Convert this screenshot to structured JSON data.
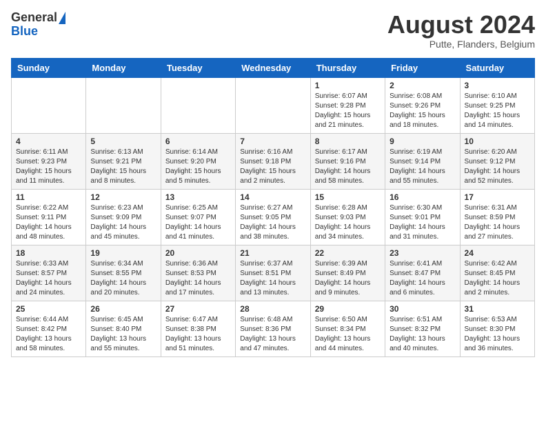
{
  "header": {
    "logo_general": "General",
    "logo_blue": "Blue",
    "month_year": "August 2024",
    "location": "Putte, Flanders, Belgium"
  },
  "weekdays": [
    "Sunday",
    "Monday",
    "Tuesday",
    "Wednesday",
    "Thursday",
    "Friday",
    "Saturday"
  ],
  "weeks": [
    [
      {
        "day": "",
        "info": ""
      },
      {
        "day": "",
        "info": ""
      },
      {
        "day": "",
        "info": ""
      },
      {
        "day": "",
        "info": ""
      },
      {
        "day": "1",
        "info": "Sunrise: 6:07 AM\nSunset: 9:28 PM\nDaylight: 15 hours\nand 21 minutes."
      },
      {
        "day": "2",
        "info": "Sunrise: 6:08 AM\nSunset: 9:26 PM\nDaylight: 15 hours\nand 18 minutes."
      },
      {
        "day": "3",
        "info": "Sunrise: 6:10 AM\nSunset: 9:25 PM\nDaylight: 15 hours\nand 14 minutes."
      }
    ],
    [
      {
        "day": "4",
        "info": "Sunrise: 6:11 AM\nSunset: 9:23 PM\nDaylight: 15 hours\nand 11 minutes."
      },
      {
        "day": "5",
        "info": "Sunrise: 6:13 AM\nSunset: 9:21 PM\nDaylight: 15 hours\nand 8 minutes."
      },
      {
        "day": "6",
        "info": "Sunrise: 6:14 AM\nSunset: 9:20 PM\nDaylight: 15 hours\nand 5 minutes."
      },
      {
        "day": "7",
        "info": "Sunrise: 6:16 AM\nSunset: 9:18 PM\nDaylight: 15 hours\nand 2 minutes."
      },
      {
        "day": "8",
        "info": "Sunrise: 6:17 AM\nSunset: 9:16 PM\nDaylight: 14 hours\nand 58 minutes."
      },
      {
        "day": "9",
        "info": "Sunrise: 6:19 AM\nSunset: 9:14 PM\nDaylight: 14 hours\nand 55 minutes."
      },
      {
        "day": "10",
        "info": "Sunrise: 6:20 AM\nSunset: 9:12 PM\nDaylight: 14 hours\nand 52 minutes."
      }
    ],
    [
      {
        "day": "11",
        "info": "Sunrise: 6:22 AM\nSunset: 9:11 PM\nDaylight: 14 hours\nand 48 minutes."
      },
      {
        "day": "12",
        "info": "Sunrise: 6:23 AM\nSunset: 9:09 PM\nDaylight: 14 hours\nand 45 minutes."
      },
      {
        "day": "13",
        "info": "Sunrise: 6:25 AM\nSunset: 9:07 PM\nDaylight: 14 hours\nand 41 minutes."
      },
      {
        "day": "14",
        "info": "Sunrise: 6:27 AM\nSunset: 9:05 PM\nDaylight: 14 hours\nand 38 minutes."
      },
      {
        "day": "15",
        "info": "Sunrise: 6:28 AM\nSunset: 9:03 PM\nDaylight: 14 hours\nand 34 minutes."
      },
      {
        "day": "16",
        "info": "Sunrise: 6:30 AM\nSunset: 9:01 PM\nDaylight: 14 hours\nand 31 minutes."
      },
      {
        "day": "17",
        "info": "Sunrise: 6:31 AM\nSunset: 8:59 PM\nDaylight: 14 hours\nand 27 minutes."
      }
    ],
    [
      {
        "day": "18",
        "info": "Sunrise: 6:33 AM\nSunset: 8:57 PM\nDaylight: 14 hours\nand 24 minutes."
      },
      {
        "day": "19",
        "info": "Sunrise: 6:34 AM\nSunset: 8:55 PM\nDaylight: 14 hours\nand 20 minutes."
      },
      {
        "day": "20",
        "info": "Sunrise: 6:36 AM\nSunset: 8:53 PM\nDaylight: 14 hours\nand 17 minutes."
      },
      {
        "day": "21",
        "info": "Sunrise: 6:37 AM\nSunset: 8:51 PM\nDaylight: 14 hours\nand 13 minutes."
      },
      {
        "day": "22",
        "info": "Sunrise: 6:39 AM\nSunset: 8:49 PM\nDaylight: 14 hours\nand 9 minutes."
      },
      {
        "day": "23",
        "info": "Sunrise: 6:41 AM\nSunset: 8:47 PM\nDaylight: 14 hours\nand 6 minutes."
      },
      {
        "day": "24",
        "info": "Sunrise: 6:42 AM\nSunset: 8:45 PM\nDaylight: 14 hours\nand 2 minutes."
      }
    ],
    [
      {
        "day": "25",
        "info": "Sunrise: 6:44 AM\nSunset: 8:42 PM\nDaylight: 13 hours\nand 58 minutes."
      },
      {
        "day": "26",
        "info": "Sunrise: 6:45 AM\nSunset: 8:40 PM\nDaylight: 13 hours\nand 55 minutes."
      },
      {
        "day": "27",
        "info": "Sunrise: 6:47 AM\nSunset: 8:38 PM\nDaylight: 13 hours\nand 51 minutes."
      },
      {
        "day": "28",
        "info": "Sunrise: 6:48 AM\nSunset: 8:36 PM\nDaylight: 13 hours\nand 47 minutes."
      },
      {
        "day": "29",
        "info": "Sunrise: 6:50 AM\nSunset: 8:34 PM\nDaylight: 13 hours\nand 44 minutes."
      },
      {
        "day": "30",
        "info": "Sunrise: 6:51 AM\nSunset: 8:32 PM\nDaylight: 13 hours\nand 40 minutes."
      },
      {
        "day": "31",
        "info": "Sunrise: 6:53 AM\nSunset: 8:30 PM\nDaylight: 13 hours\nand 36 minutes."
      }
    ]
  ]
}
